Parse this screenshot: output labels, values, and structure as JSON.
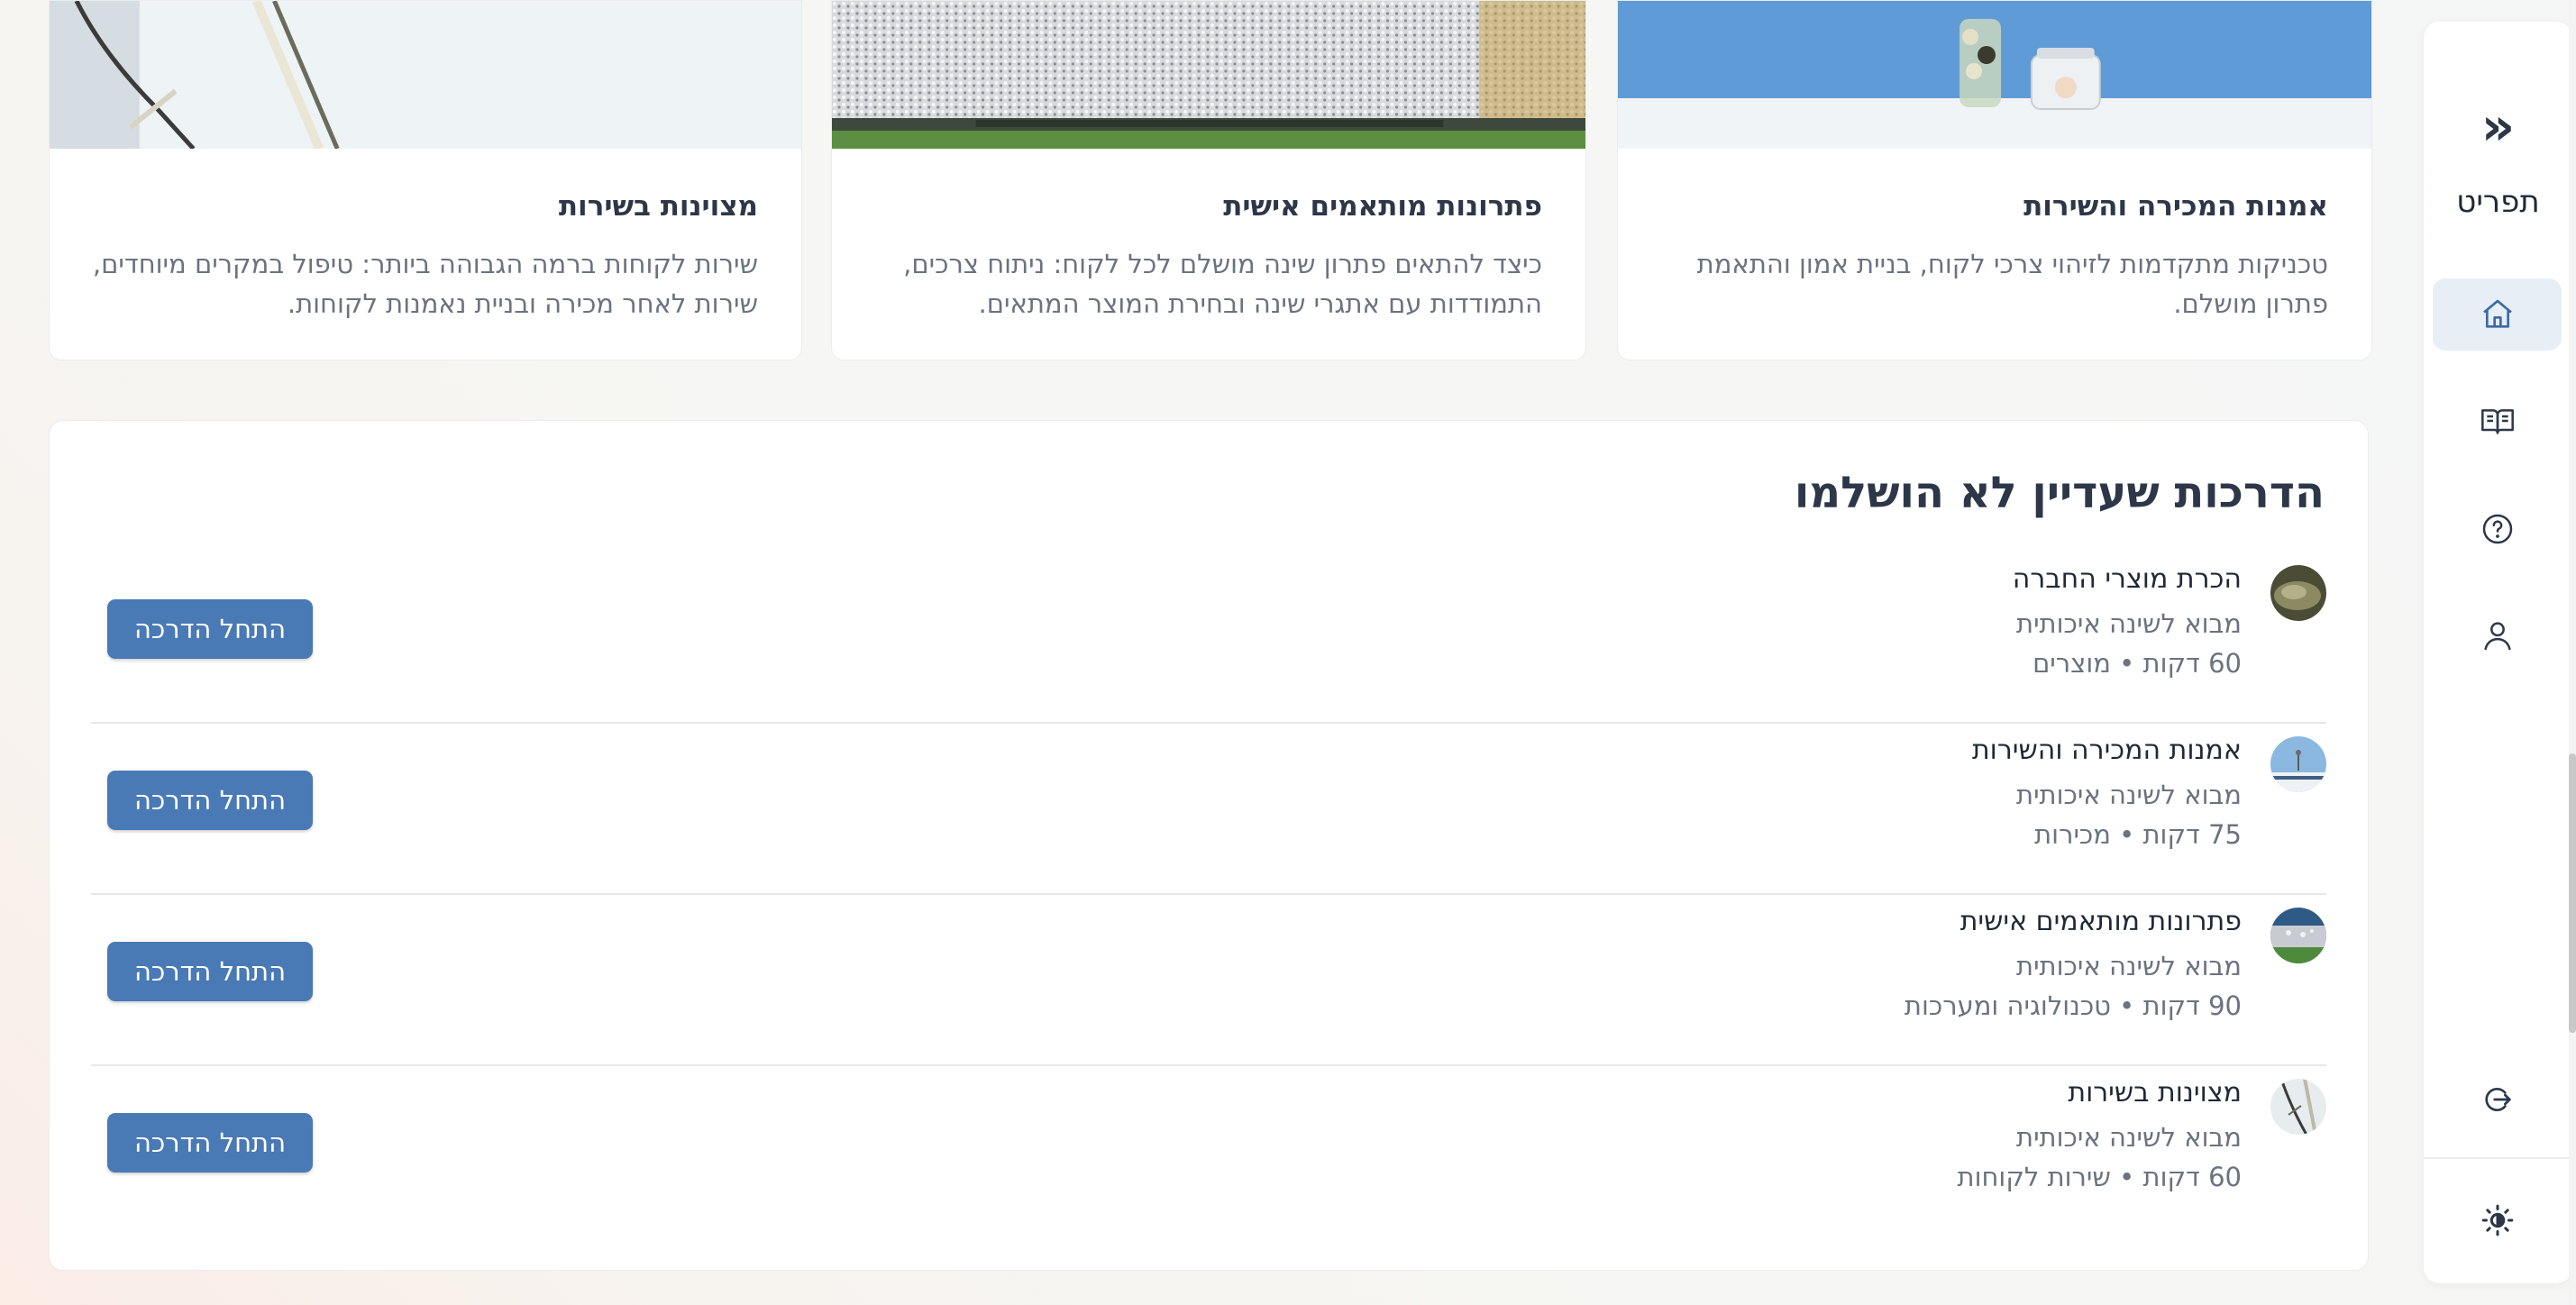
{
  "sidebar": {
    "collapse_glyph": "«",
    "title": "תפריט",
    "items": [
      {
        "icon": "home-icon",
        "active": true
      },
      {
        "icon": "book-icon",
        "active": false
      },
      {
        "icon": "help-icon",
        "active": false
      },
      {
        "icon": "user-icon",
        "active": false
      },
      {
        "icon": "logout-icon",
        "active": false
      },
      {
        "icon": "theme-toggle-icon",
        "active": false
      }
    ]
  },
  "cards": [
    {
      "title": "אמנות המכירה והשירות",
      "description": "טכניקות מתקדמות לזיהוי צרכי לקוח, בניית אמון והתאמת פתרון מושלם."
    },
    {
      "title": "פתרונות מותאמים אישית",
      "description": "כיצד להתאים פתרון שינה מושלם לכל לקוח: ניתוח צרכים, התמודדות עם אתגרי שינה ובחירת המוצר המתאים."
    },
    {
      "title": "מצוינות בשירות",
      "description": "שירות לקוחות ברמה הגבוהה ביותר: טיפול במקרים מיוחדים, שירות לאחר מכירה ובניית נאמנות לקוחות."
    }
  ],
  "incomplete": {
    "title": "הדרכות שעדיין לא הושלמו",
    "button_label": "התחל הדרכה",
    "items": [
      {
        "title": "הכרת מוצרי החברה",
        "subtitle": "מבוא לשינה איכותית",
        "meta": "60 דקות • מוצרים"
      },
      {
        "title": "אמנות המכירה והשירות",
        "subtitle": "מבוא לשינה איכותית",
        "meta": "75 דקות • מכירות"
      },
      {
        "title": "פתרונות מותאמים אישית",
        "subtitle": "מבוא לשינה איכותית",
        "meta": "90 דקות • טכנולוגיה ומערכות"
      },
      {
        "title": "מצוינות בשירות",
        "subtitle": "מבוא לשינה איכותית",
        "meta": "60 דקות • שירות לקוחות"
      }
    ]
  },
  "colors": {
    "accent": "#4a7ab5",
    "active_nav_bg": "#e8eef5"
  }
}
